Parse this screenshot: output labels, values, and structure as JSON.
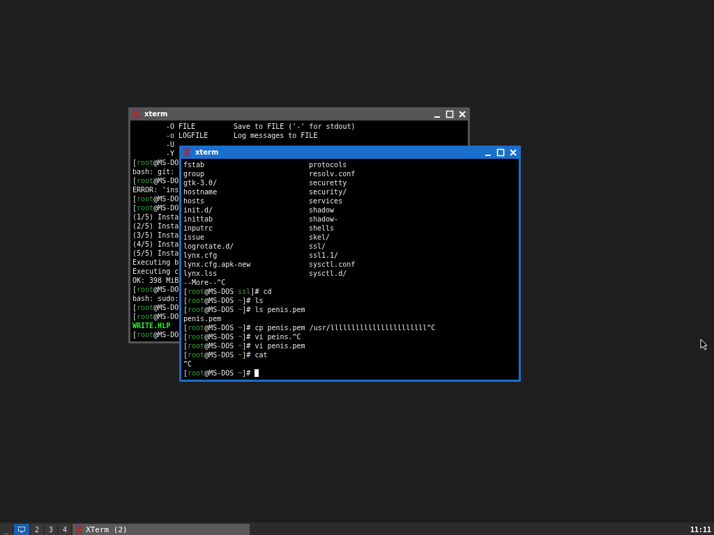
{
  "windows": [
    {
      "title": "xterm",
      "focused": false,
      "options": [
        {
          "flag": "-O FILE",
          "description": "Save to FILE ('-' for stdout)"
        },
        {
          "flag": "-o LOGFILE",
          "description": "Log messages to FILE"
        },
        {
          "flag": "-U"
        },
        {
          "flag": "-Y"
        }
      ],
      "lines": [
        [
          {
            "text": "[",
            "kind": "plain"
          },
          {
            "text": "root",
            "kind": "green"
          },
          {
            "text": "@MS-DO",
            "kind": "plain"
          }
        ],
        [
          {
            "text": "bash: git:",
            "kind": "plain"
          }
        ],
        [
          {
            "text": "[",
            "kind": "plain"
          },
          {
            "text": "root",
            "kind": "green"
          },
          {
            "text": "@MS-DO",
            "kind": "plain"
          }
        ],
        [
          {
            "text": "ERROR: 'ins",
            "kind": "plain"
          }
        ],
        [
          {
            "text": "[",
            "kind": "plain"
          },
          {
            "text": "root",
            "kind": "green"
          },
          {
            "text": "@MS-DO",
            "kind": "plain"
          }
        ],
        [
          {
            "text": "[",
            "kind": "plain"
          },
          {
            "text": "root",
            "kind": "green"
          },
          {
            "text": "@MS-DO",
            "kind": "plain"
          }
        ],
        [
          {
            "text": "(1/5) Insta",
            "kind": "plain"
          }
        ],
        [
          {
            "text": "(2/5) Insta",
            "kind": "plain"
          }
        ],
        [
          {
            "text": "(3/5) Insta",
            "kind": "plain"
          }
        ],
        [
          {
            "text": "(4/5) Insta",
            "kind": "plain"
          }
        ],
        [
          {
            "text": "(5/5) Insta",
            "kind": "plain"
          }
        ],
        [
          {
            "text": "Executing b",
            "kind": "plain"
          }
        ],
        [
          {
            "text": "Executing c",
            "kind": "plain"
          }
        ],
        [
          {
            "text": "OK: 398 MiB",
            "kind": "plain"
          }
        ],
        [
          {
            "text": "[",
            "kind": "plain"
          },
          {
            "text": "root",
            "kind": "green"
          },
          {
            "text": "@MS-DO",
            "kind": "plain"
          }
        ],
        [
          {
            "text": "bash: sudo:",
            "kind": "plain"
          }
        ],
        [
          {
            "text": "[",
            "kind": "plain"
          },
          {
            "text": "root",
            "kind": "green"
          },
          {
            "text": "@MS-DO",
            "kind": "plain"
          }
        ],
        [
          {
            "text": "[",
            "kind": "plain"
          },
          {
            "text": "root",
            "kind": "green"
          },
          {
            "text": "@MS-DO",
            "kind": "plain"
          }
        ],
        [
          {
            "text": "WRITE.HLP",
            "kind": "bright"
          }
        ],
        [
          {
            "text": "[",
            "kind": "plain"
          },
          {
            "text": "root",
            "kind": "green"
          },
          {
            "text": "@MS-DO",
            "kind": "plain"
          }
        ]
      ]
    },
    {
      "title": "xterm",
      "focused": true,
      "listing": [
        [
          "fstab",
          "protocols"
        ],
        [
          "group",
          "resolv.conf"
        ],
        [
          "gtk-3.0/",
          "securetty"
        ],
        [
          "hostname",
          "security/"
        ],
        [
          "hosts",
          "services"
        ],
        [
          "init.d/",
          "shadow"
        ],
        [
          "inittab",
          "shadow-"
        ],
        [
          "inputrc",
          "shells"
        ],
        [
          "issue",
          "skel/"
        ],
        [
          "logrotate.d/",
          "ssl/"
        ],
        [
          "lynx.cfg",
          "ssl1.1/"
        ],
        [
          "lynx.cfg.apk-new",
          "sysctl.conf"
        ],
        [
          "lynx.lss",
          "sysctl.d/"
        ]
      ],
      "lines": [
        [
          {
            "text": "--More--^C",
            "kind": "plain"
          }
        ],
        [
          {
            "text": "[",
            "kind": "plain"
          },
          {
            "text": "root",
            "kind": "green"
          },
          {
            "text": "@MS-DOS ",
            "kind": "plain"
          },
          {
            "text": "ssl",
            "kind": "green"
          },
          {
            "text": "]# cd",
            "kind": "plain"
          }
        ],
        [
          {
            "text": "[",
            "kind": "plain"
          },
          {
            "text": "root",
            "kind": "green"
          },
          {
            "text": "@MS-DOS ",
            "kind": "plain"
          },
          {
            "text": "~",
            "kind": "green"
          },
          {
            "text": "]# ls",
            "kind": "plain"
          }
        ],
        [
          {
            "text": "[",
            "kind": "plain"
          },
          {
            "text": "root",
            "kind": "green"
          },
          {
            "text": "@MS-DOS ",
            "kind": "plain"
          },
          {
            "text": "~",
            "kind": "green"
          },
          {
            "text": "]# ls penis.pem",
            "kind": "plain"
          }
        ],
        [
          {
            "text": "penis.pem",
            "kind": "plain"
          }
        ],
        [
          {
            "text": "[",
            "kind": "plain"
          },
          {
            "text": "root",
            "kind": "green"
          },
          {
            "text": "@MS-DOS ",
            "kind": "plain"
          },
          {
            "text": "~",
            "kind": "green"
          },
          {
            "text": "]# cp penis.pem /usr/lllllllllllllllllllllll^C",
            "kind": "plain"
          }
        ],
        [
          {
            "text": "[",
            "kind": "plain"
          },
          {
            "text": "root",
            "kind": "green"
          },
          {
            "text": "@MS-DOS ",
            "kind": "plain"
          },
          {
            "text": "~",
            "kind": "green"
          },
          {
            "text": "]# vi peins.^C",
            "kind": "plain"
          }
        ],
        [
          {
            "text": "[",
            "kind": "plain"
          },
          {
            "text": "root",
            "kind": "green"
          },
          {
            "text": "@MS-DOS ",
            "kind": "plain"
          },
          {
            "text": "~",
            "kind": "green"
          },
          {
            "text": "]# vi penis.pem",
            "kind": "plain"
          }
        ],
        [
          {
            "text": "[",
            "kind": "plain"
          },
          {
            "text": "root",
            "kind": "green"
          },
          {
            "text": "@MS-DOS ",
            "kind": "plain"
          },
          {
            "text": "~",
            "kind": "green"
          },
          {
            "text": "]# cat",
            "kind": "plain"
          }
        ],
        [
          {
            "text": "^C",
            "kind": "plain"
          }
        ],
        [
          {
            "text": "[",
            "kind": "plain"
          },
          {
            "text": "root",
            "kind": "green"
          },
          {
            "text": "@MS-DOS ",
            "kind": "plain"
          },
          {
            "text": "~",
            "kind": "green"
          },
          {
            "text": "]# ",
            "kind": "plain"
          }
        ]
      ]
    }
  ],
  "taskbar": {
    "menu": "_",
    "workspaces": [
      {
        "kind": "icon",
        "selected": true
      },
      {
        "kind": "number",
        "label": "2",
        "selected": false
      },
      {
        "kind": "number",
        "label": "3",
        "selected": false
      },
      {
        "kind": "number",
        "label": "4",
        "selected": false
      }
    ],
    "task": "XTerm (2)",
    "clock": "11:11"
  }
}
